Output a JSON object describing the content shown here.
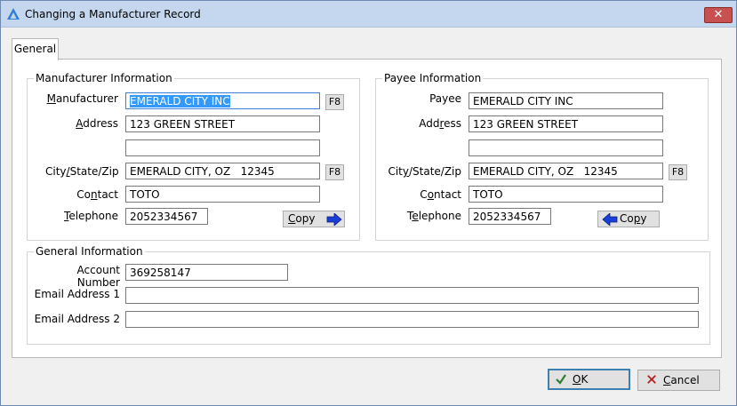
{
  "window": {
    "title": "Changing a Manufacturer Record",
    "close_glyph": "✕"
  },
  "tabs": [
    {
      "label": "General"
    }
  ],
  "manufacturer_info": {
    "title": "Manufacturer Information",
    "labels": {
      "manufacturer": "Manufacturer",
      "address": "Address",
      "city_state_zip": "City/State/Zip",
      "contact": "Contact",
      "telephone": "Telephone"
    },
    "values": {
      "manufacturer": "EMERALD CITY INC",
      "address1": "123 GREEN STREET",
      "address2": "",
      "city_state_zip": "EMERALD CITY, OZ   12345",
      "contact": "TOTO",
      "telephone": "2052334567"
    },
    "f8_label": "F8",
    "copy_label": "Copy"
  },
  "payee_info": {
    "title": "Payee Information",
    "labels": {
      "payee": "Payee",
      "address": "Address",
      "city_state_zip": "City/State/Zip",
      "contact": "Contact",
      "telephone": "Telephone"
    },
    "values": {
      "payee": "EMERALD CITY INC",
      "address1": "123 GREEN STREET",
      "address2": "",
      "city_state_zip": "EMERALD CITY, OZ   12345",
      "contact": "TOTO",
      "telephone": "2052334567"
    },
    "f8_label": "F8",
    "copy_label": "Copy"
  },
  "general_info": {
    "title": "General Information",
    "labels": {
      "account_number": "Account Number",
      "email1": "Email Address 1",
      "email2": "Email Address 2"
    },
    "values": {
      "account_number": "369258147",
      "email1": "",
      "email2": ""
    }
  },
  "buttons": {
    "ok": "OK",
    "cancel": "Cancel"
  },
  "colors": {
    "accent": "#3399ff",
    "arrow": "#1a3fd6",
    "ok_check": "#2e7d32",
    "cancel_x": "#b71c1c"
  }
}
